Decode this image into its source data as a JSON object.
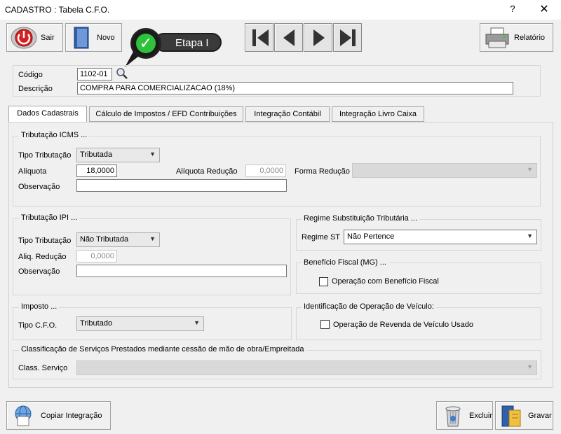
{
  "window": {
    "title": "CADASTRO : Tabela C.F.O.",
    "help": "?",
    "close": "✕"
  },
  "toolbar": {
    "exit_label": "Sair",
    "new_label": "Novo",
    "report_label": "Relatório"
  },
  "callout": {
    "label": "Etapa I"
  },
  "header": {
    "code_label": "Código",
    "code_value": "1102-01",
    "desc_label": "Descrição",
    "desc_value": "COMPRA PARA COMERCIALIZACAO (18%)"
  },
  "tabs": [
    {
      "label": "Dados Cadastrais",
      "active": true
    },
    {
      "label": "Cálculo de Impostos / EFD Contribuições"
    },
    {
      "label": "Integração Contábil"
    },
    {
      "label": "Integração Livro Caixa"
    }
  ],
  "icms": {
    "title": "Tributação ICMS ...",
    "tipo_label": "Tipo Tributação",
    "tipo_value": "Tributada",
    "aliquota_label": "Alíquota",
    "aliquota_value": "18,0000",
    "aliq_red_label": "Alíquota Redução",
    "aliq_red_value": "0,0000",
    "forma_red_label": "Forma Redução",
    "forma_red_value": "",
    "obs_label": "Observação",
    "obs_value": ""
  },
  "ipi": {
    "title": "Tributação IPI ...",
    "tipo_label": "Tipo Tributação",
    "tipo_value": "Não Tributada",
    "aliq_red_label": "Aliq. Redução",
    "aliq_red_value": "0,0000",
    "obs_label": "Observação",
    "obs_value": ""
  },
  "regime": {
    "title": "Regime Substituição Tributária ...",
    "label": "Regime ST",
    "value": "Não Pertence"
  },
  "beneficio": {
    "title": "Benefício Fiscal (MG) ...",
    "checkbox_label": "Operação com Benefício Fiscal"
  },
  "imposto": {
    "title": "Imposto ...",
    "label": "Tipo C.F.O.",
    "value": "Tributado"
  },
  "veiculo": {
    "title": "Identificação de Operação de Veículo:",
    "checkbox_label": "Operação de Revenda de Veículo Usado"
  },
  "servicos": {
    "title": "Classificação de Serviços Prestados mediante cessão de mão de obra/Empreitada",
    "label": "Class. Serviço",
    "value": ""
  },
  "footer": {
    "copy_label": "Copiar Integração",
    "delete_label": "Excluir",
    "save_label": "Gravar"
  },
  "colors": {
    "accent_green": "#2ec23a",
    "exit_red": "#d42020",
    "panel_border": "#d7d7d7"
  }
}
